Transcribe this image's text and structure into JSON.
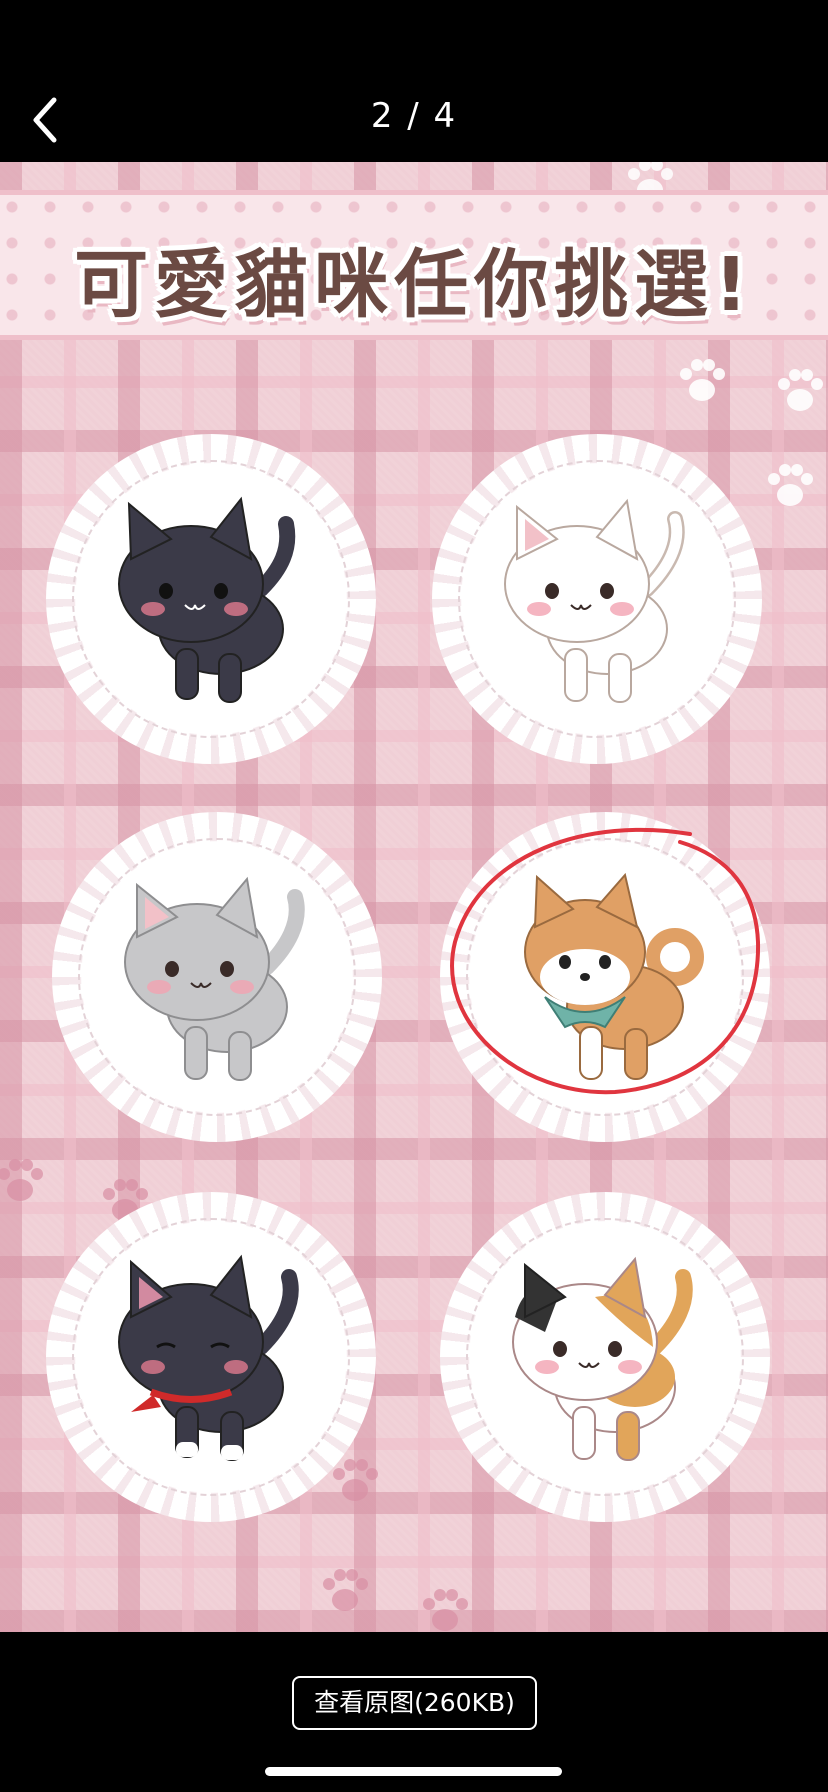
{
  "viewer": {
    "counter": "2 / 4",
    "back_icon": "chevron-left-icon"
  },
  "image": {
    "banner_title": "可愛貓咪任你挑選!",
    "characters": [
      {
        "id": "black-cat",
        "body": "#3b3a48",
        "ear": "#3b3a48",
        "inner": "#2e2d39"
      },
      {
        "id": "white-cat",
        "body": "#ffffff",
        "ear": "#ffffff",
        "inner": "#f2c1c8"
      },
      {
        "id": "gray-cat",
        "body": "#c7c7c9",
        "ear": "#c7c7c9",
        "inner": "#f2c1c8"
      },
      {
        "id": "shiba-dog",
        "body": "#e0a065",
        "ear": "#e0a065",
        "inner": "#fff"
      },
      {
        "id": "sleepy-black-cat",
        "body": "#3b3a48",
        "ear": "#3b3a48",
        "inner": "#d28aa0"
      },
      {
        "id": "calico-cat",
        "body": "#ffffff",
        "ear": "#ffffff",
        "inner": "#f2c1c8"
      }
    ],
    "highlight_color": "#e0353f"
  },
  "footer": {
    "view_original_label": "查看原图(260KB)"
  }
}
